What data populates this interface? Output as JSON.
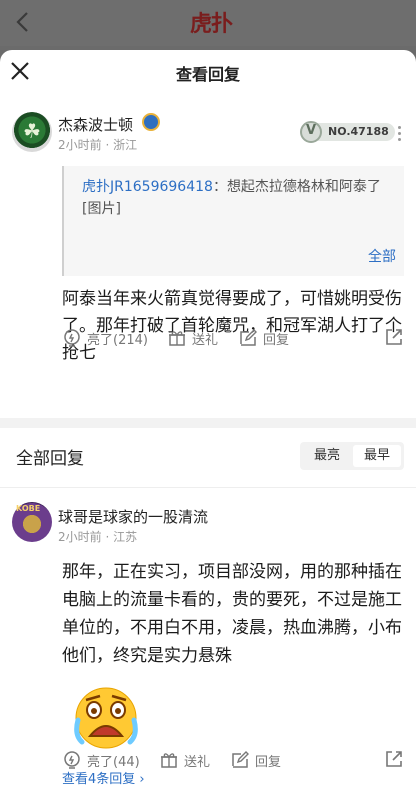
{
  "topbar": {
    "logo_text": "虎扑"
  },
  "sheet": {
    "title": "查看回复"
  },
  "main_comment": {
    "username": "杰森波士顿",
    "meta": "2小时前 · 浙江",
    "vip_number": "NO.47188",
    "quote_user": "虎扑JR1659696418",
    "quote_sep": "：",
    "quote_text": "想起杰拉德格林和阿泰了[图片]",
    "quote_all": "全部",
    "body": "阿泰当年来火箭真觉得要成了，可惜姚明受伤了。那年打破了首轮魔咒，和冠军湖人打了个抢七",
    "like_label": "亮了(214)",
    "gift_label": "送礼",
    "reply_label": "回复"
  },
  "replies_header": {
    "label": "全部回复",
    "sort_options": [
      "最亮",
      "最早"
    ],
    "sort_selected": "最早"
  },
  "reply": {
    "username": "球哥是球家的一股清流",
    "avatar_text": "KOBE",
    "meta": "2小时前 · 江苏",
    "body": "那年，正在实习，项目部没网，用的那种插在电脑上的流量卡看的，贵的要死，不过是施工单位的，不用白不用，凌晨，热血沸腾，小布他们，终究是实力悬殊",
    "view_replies": "查看4条回复 ›",
    "like_label": "亮了(44)",
    "gift_label": "送礼",
    "reply_label": "回复"
  },
  "colors": {
    "accent_blue": "#2d6fc4",
    "muted_text": "#999999"
  }
}
